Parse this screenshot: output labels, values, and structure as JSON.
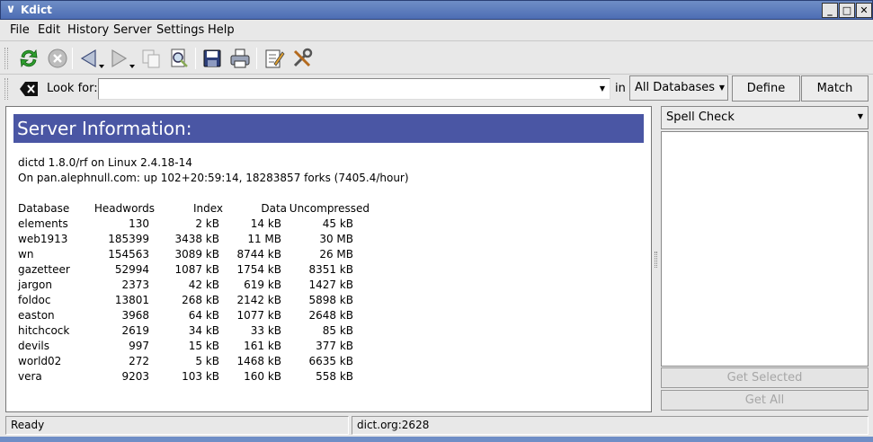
{
  "window": {
    "title": "Kdict"
  },
  "menu": [
    "File",
    "Edit",
    "History",
    "Server",
    "Settings",
    "Help"
  ],
  "toolbar_icons": [
    "refresh-icon",
    "stop-icon",
    "back-icon",
    "forward-icon",
    "copy-icon",
    "find-icon",
    "save-icon",
    "print-icon",
    "edit-icon",
    "settings-icon"
  ],
  "search": {
    "clear_icon": "clear-icon",
    "label": "Look for:",
    "value": "",
    "in_label": "in",
    "database": "All Databases",
    "define_label": "Define",
    "match_label": "Match"
  },
  "result": {
    "heading": "Server Information:",
    "line1": "dictd 1.8.0/rf on Linux 2.4.18-14",
    "line2": "On pan.alephnull.com: up 102+20:59:14, 18283857 forks (7405.4/hour)",
    "columns": [
      "Database",
      "Headwords",
      "Index",
      "Data",
      "Uncompressed"
    ],
    "rows": [
      [
        "elements",
        "130",
        "2 kB",
        "14 kB",
        "45 kB"
      ],
      [
        "web1913",
        "185399",
        "3438 kB",
        "11 MB",
        "30 MB"
      ],
      [
        "wn",
        "154563",
        "3089 kB",
        "8744 kB",
        "26 MB"
      ],
      [
        "gazetteer",
        "52994",
        "1087 kB",
        "1754 kB",
        "8351 kB"
      ],
      [
        "jargon",
        "2373",
        "42 kB",
        "619 kB",
        "1427 kB"
      ],
      [
        "foldoc",
        "13801",
        "268 kB",
        "2142 kB",
        "5898 kB"
      ],
      [
        "easton",
        "3968",
        "64 kB",
        "1077 kB",
        "2648 kB"
      ],
      [
        "hitchcock",
        "2619",
        "34 kB",
        "33 kB",
        "85 kB"
      ],
      [
        "devils",
        "997",
        "15 kB",
        "161 kB",
        "377 kB"
      ],
      [
        "world02",
        "272",
        "5 kB",
        "1468 kB",
        "6635 kB"
      ],
      [
        "vera",
        "9203",
        "103 kB",
        "160 kB",
        "558 kB"
      ]
    ]
  },
  "side": {
    "mode": "Spell Check",
    "get_selected": "Get Selected",
    "get_all": "Get All"
  },
  "status": {
    "left": "Ready",
    "right": "dict.org:2628"
  }
}
